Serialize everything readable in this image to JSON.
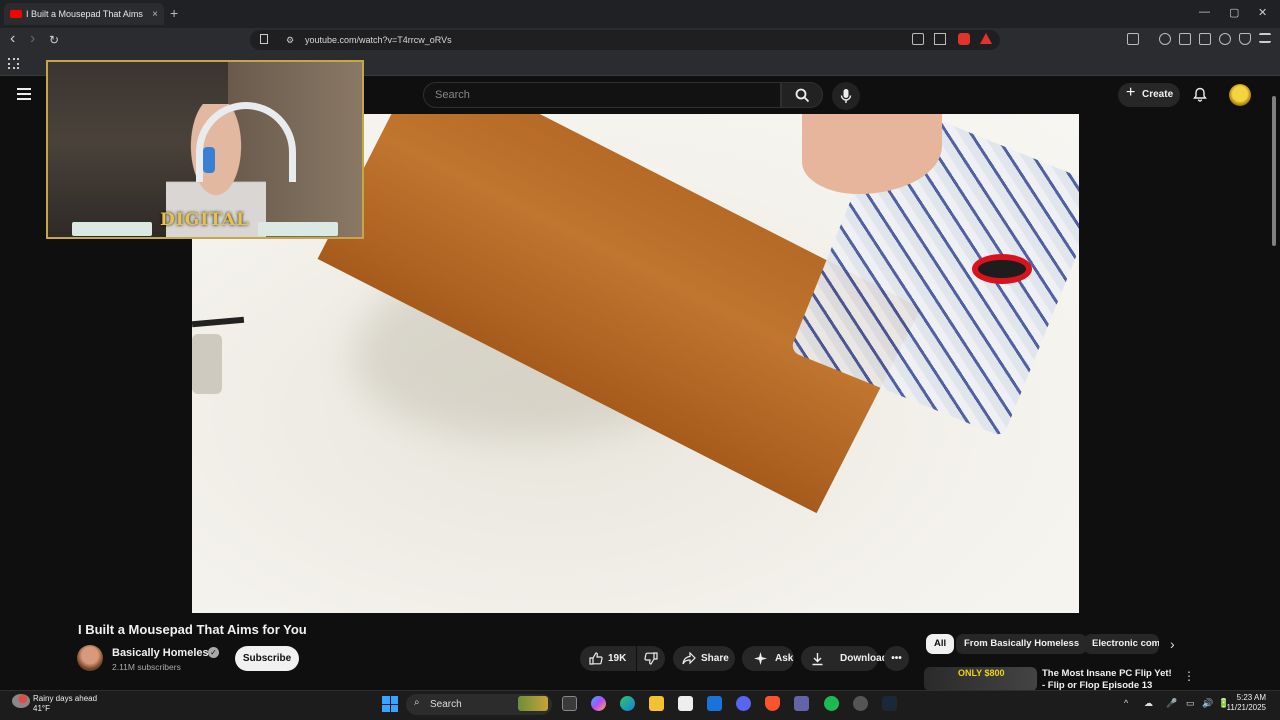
{
  "browser": {
    "tab_title": "I Built a Mousepad That Aims",
    "tab_close": "×",
    "new_tab": "+",
    "url": "youtube.com/watch?v=T4rrcw_oRVs",
    "window_controls": [
      "—",
      "▢",
      "✕"
    ],
    "nav": {
      "back": "‹",
      "forward": "›",
      "reload": "↻"
    }
  },
  "youtube": {
    "search_placeholder": "Search",
    "create_label": "Create",
    "create_plus": "+",
    "video": {
      "title": "I Built a Mousepad That Aims for You",
      "channel_name": "Basically Homeless",
      "subscribers": "2.11M subscribers",
      "subscribe_label": "Subscribe",
      "likes": "19K",
      "share_label": "Share",
      "ask_label": "Ask",
      "download_label": "Download",
      "more_label": "•••",
      "verified_mark": "✓"
    },
    "webcam_logo": "DIGITAL",
    "chips": [
      "All",
      "From Basically Homeless",
      "Electronic comp"
    ],
    "chip_next": "›",
    "recommendation": {
      "thumb_text": "ONLY $800",
      "title": "The Most Insane PC Flip Yet! - Flip or Flop Episode 13",
      "menu": "⋮"
    }
  },
  "taskbar": {
    "weather_line1": "Rainy days ahead",
    "weather_line2": "41°F",
    "search_label": "Search",
    "search_icon": "⌕",
    "time": "5:23 AM",
    "date": "11/21/2025",
    "tray_icons": [
      "^",
      "☁",
      "🎤",
      "▭",
      "🔊",
      "🔋"
    ]
  },
  "colors": {
    "accent_red": "#ff0000",
    "chip_active_bg": "#f1f1f1",
    "webcam_border": "#c7a64a"
  }
}
